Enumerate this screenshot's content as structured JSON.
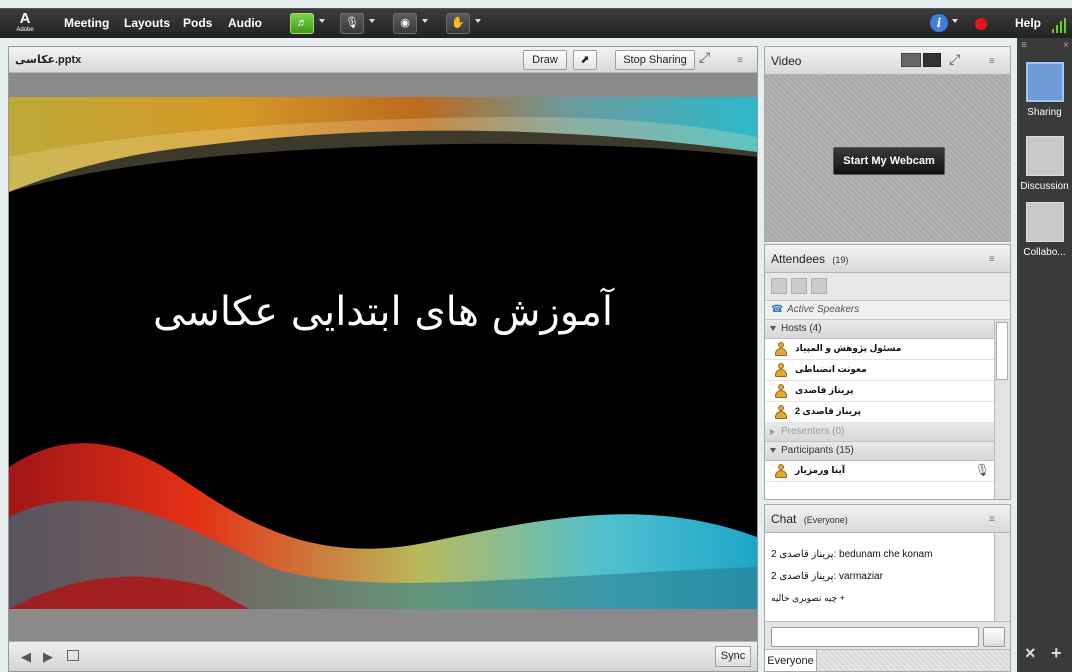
{
  "app": {
    "logo_text": "Adobe"
  },
  "menu": {
    "meeting": "Meeting",
    "layouts": "Layouts",
    "pods": "Pods",
    "audio": "Audio",
    "help": "Help"
  },
  "share": {
    "title": "عکاسی.pptx",
    "draw_label": "Draw",
    "stop_sharing_label": "Stop Sharing",
    "slide_title": "آموزش های ابتدایی عکاسی",
    "sync_label": "Sync"
  },
  "video": {
    "title": "Video",
    "webcam_button": "Start My Webcam"
  },
  "attendees": {
    "title": "Attendees",
    "count": "(19)",
    "active_speakers": "Active Speakers",
    "groups": [
      {
        "label": "Hosts (4)"
      },
      {
        "label": "Presenters (0)"
      },
      {
        "label": "Participants (15)"
      }
    ],
    "hosts": [
      "مسئول پژوهش و المپیاد",
      "معونت انضباطی",
      "پریناز قاصدی",
      "پریناز قاصدی 2"
    ],
    "participants": [
      "آینا ورمزیار"
    ]
  },
  "chat": {
    "title": "Chat",
    "scope": "(Everyone)",
    "messages": [
      "پریناز قاصدی 2: bedunam che konam",
      "پریناز قاصدی 2: varmaziar",
      "+ چیه تصویری خالیه"
    ],
    "tab_label": "Everyone"
  },
  "layouts_panel": {
    "items": [
      {
        "label": "Sharing",
        "selected": true
      },
      {
        "label": "Discussion",
        "selected": false
      },
      {
        "label": "Collabo...",
        "selected": false
      }
    ]
  },
  "colors": {
    "audio_on": "#4caf1f",
    "recording": "#e91515",
    "accent_blue": "#3f7ee0"
  },
  "icons": [
    "speaker-icon",
    "microphone-icon",
    "webcam-icon",
    "raise-hand-icon",
    "info-icon",
    "record-icon",
    "signal-icon",
    "pointer-icon",
    "fullscreen-icon",
    "pod-menu-icon",
    "prev-slide-icon",
    "next-slide-icon",
    "notes-icon",
    "phone-icon",
    "person-icon",
    "send-icon"
  ]
}
